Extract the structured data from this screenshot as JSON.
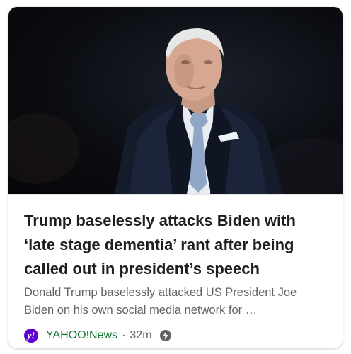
{
  "article": {
    "headline": "Trump baselessly attacks Biden with ‘late stage dementia’ rant after being called out in president’s speech",
    "snippet": "Donald Trump baselessly attacked US President Joe Biden on his own social media network for …",
    "source": {
      "logo_letter": "y!",
      "name": "YAHOO!News",
      "separator": "·",
      "age": "32m",
      "badge_icon": "lightning-bolt-icon"
    },
    "image_icon": "portrait-photo-icon"
  },
  "colors": {
    "source_logo_bg": "#6001d2",
    "source_name": "#137333",
    "headline": "#1f1f1f",
    "snippet": "#5f6368"
  }
}
